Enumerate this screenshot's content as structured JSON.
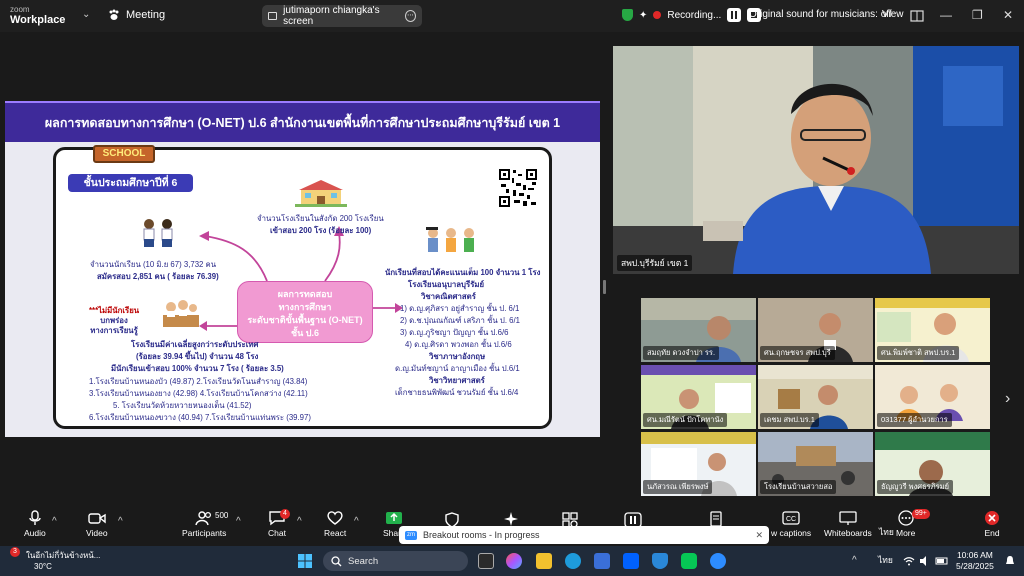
{
  "app": {
    "logo_line1": "zoom",
    "logo_line2": "Workplace",
    "meeting_label": "Meeting"
  },
  "share": {
    "label": "jutimaporn chiangka's screen",
    "more": "⋯"
  },
  "recording": {
    "status": "Recording...",
    "original_sound": "Original sound for musicians: off",
    "view": "View"
  },
  "slide": {
    "title": "ผลการทดสอบทางการศึกษา (O-NET) ป.6 สำนักงานเขตพื้นที่การศึกษาประถมศึกษาบุรีรัมย์ เขต 1",
    "school_sign": "SCHOOL",
    "grade_tag": "ชั้นประถมศึกษาปีที่ 6",
    "schools_line1": "จำนวนโรงเรียนในสังกัด 200 โรงเรียน",
    "schools_line2": "เข้าสอบ 200 โรง  (ร้อยละ 100)",
    "students_line1": "จำนวนนักเรียน (10 มิ.ย 67) 3,732  คน",
    "students_line2": "สมัครสอบ 2,851 คน ( ร้อยละ 76.39)",
    "center_line1": "ผลการทดสอบ",
    "center_line2": "ทางการศึกษา",
    "center_line3": "ระดับชาติขั้นพื้นฐาน (O-NET)",
    "center_line4": "ชั้น ป.6",
    "note_line1": "***ไม่มีนักเรียน",
    "note_line2": "บกพร่อง",
    "note_line3": "ทางการเรียนรู้",
    "full_score_header": "นักเรียนที่สอบได้คะแนนเต็ม 100  จำนวน 1 โรง",
    "full_score_school": "โรงเรียนอนุบาลบุรีรัมย์",
    "math_header": "วิชาคณิตศาสตร์",
    "math_1": "1) ด.ญ.ศุภิสรา อยู่สำราญ ชั้น ป. 6/1",
    "math_2": "2) ด.ช.ปุณณกัณฑ์ เสริภา ชั้น ป. 6/1",
    "math_3": "3) ด.ญ.ภูริชญา ปัญญา ชั้น ป.6/6",
    "math_4": "4) ด.ญ.ศิรดา พวงพอก ชั้น ป.6/6",
    "thai_header": "วิชาภาษาอังกฤษ",
    "thai_1": "ด.ญ.มันท์ชญาน์  อาญาเมือง ชั้น ป.6/1",
    "sci_header": "วิชาวิทยาศาสตร์",
    "sci_1": "เด็กชายธนพิพัฒน์  ชวนรัมย์ ชั้น ป.6/4",
    "above_header": "โรงเรียนมีค่าเฉลี่ยสูงกว่าระดับประเทศ",
    "above_line2": "(ร้อยละ 39.94 ขึ้นไป)  จำนวน 48 โรง",
    "above_line3": "มีนักเรียนเข้าสอบ 100% จำนวน 7 โรง  ( ร้อยละ 3.5)",
    "above_line4": "1.โรงเรียนบ้านหนองบัว (49.87)   2.โรงเรียนวัดโนนสำราญ (43.84)",
    "above_line5": "3.โรงเรียนบ้านหนองยาง (42.98) 4.โรงเรียนบ้านโคกสว่าง (42.11)",
    "above_line6": "5. โรงเรียนวัดห้วยหวายหนองเต็น (41.52)",
    "above_line7": "6.โรงเรียนบ้านหนองขวาง (40.94)  7.โรงเรียนบ้านแท่นพระ (39.97)"
  },
  "speaker_label": "สพป.บุรีรัมย์ เขต 1",
  "tiles": [
    "สมฤทัย ดวงจำปา รร.",
    "ศน.ฤกษชจร สพป.บุรี",
    "ศน.พิมพ์ชาติ สพป.บร.1",
    "ศน.มณีรัตน์ ปักโคทานัง",
    "เดชม สพป.บร.1",
    "031377 ผู้อำนวยการ",
    "นภัสวรณ เพียรพงษ์",
    "โรงเรียนบ้านสวายสอ",
    "ธัญญูวรี พงศธรภิรมย์"
  ],
  "toolbar": {
    "audio": "Audio",
    "video": "Video",
    "participants": "Participants",
    "participants_count": "500",
    "chat": "Chat",
    "chat_badge": "4",
    "react": "React",
    "share": "Share",
    "captions": "w captions",
    "whiteboards": "Whiteboards",
    "thai": "ไทย",
    "more": "More",
    "more_badge": "99+",
    "end": "End"
  },
  "breakout": {
    "label": "Breakout rooms - In progress",
    "close": "✕"
  },
  "taskbar": {
    "weather_title": "ในอีกไม่กี่วันข้างหน้...",
    "weather_temp": "30°C",
    "weather_badge": "3",
    "search": "Search",
    "lang": "ไทย",
    "time": "10:06 AM",
    "date": "5/28/2025"
  },
  "colors": {
    "slide_title_bg": "#3e2a9a",
    "center_box": "#f19ad2",
    "record": "#e02828",
    "end": "#e02828"
  }
}
